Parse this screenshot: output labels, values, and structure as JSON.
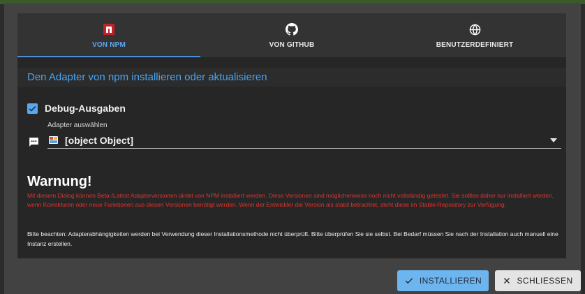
{
  "tabs": [
    {
      "label": "VON NPM",
      "icon": "npm-icon",
      "active": true
    },
    {
      "label": "VON GITHUB",
      "icon": "github-icon",
      "active": false
    },
    {
      "label": "BENUTZERDEFINIERT",
      "icon": "globe-icon",
      "active": false
    }
  ],
  "title": "Den Adapter von npm installieren oder aktualisieren",
  "debug": {
    "label": "Debug-Ausgaben",
    "checked": true
  },
  "adapter_select": {
    "label": "Adapter auswählen",
    "value": "[object Object]"
  },
  "warning": {
    "heading": "Warnung!",
    "text": "Mit diesem Dialog können Beta-/Latest Adapterversionen direkt von NPM installiert werden. Diese Versionen sind möglicherweise noch nicht vollständig getestet. Sie sollten daher nur installiert werden, wenn Korrekturen oder neue Funktionen aus diesen Versionen benötigt werden. Wenn der Entwickler die Version als stabil betrachtet, steht diese im Stable-Repository zur Verfügung."
  },
  "note": "Bitte beachten: Adapterabhängigkeiten werden bei Verwendung dieser Installationsmethode nicht überprüft. Bitte überprüfen Sie sie selbst. Bei Bedarf müssen Sie nach der Installation auch manuell eine Instanz erstellen.",
  "buttons": {
    "install": "INSTALLIEREN",
    "close": "SCHLIESSEN"
  },
  "colors": {
    "accent": "#4aa3f0",
    "warning": "#e0332b",
    "install_button": "#6db5ee",
    "close_button": "#e4e4e4"
  }
}
